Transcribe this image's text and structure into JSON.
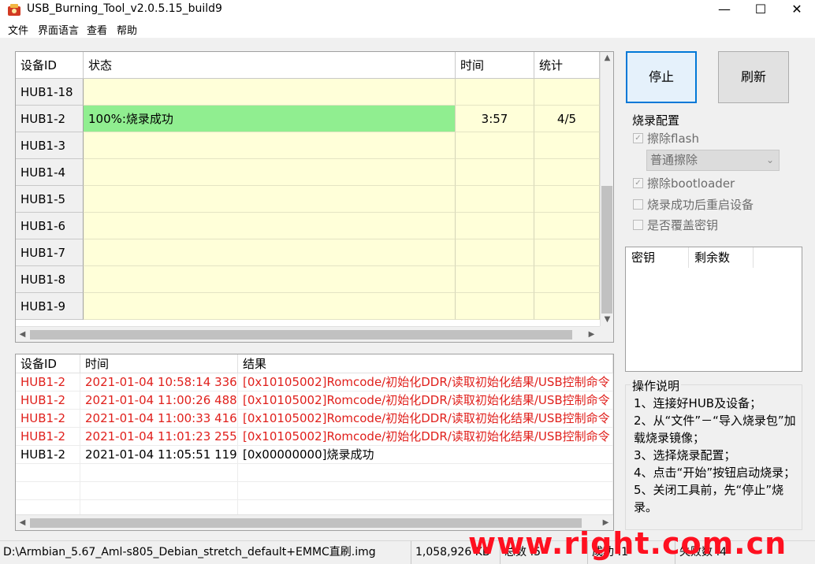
{
  "window": {
    "title": "USB_Burning_Tool_v2.0.5.15_build9",
    "minimize": "—",
    "maximize": "☐",
    "close": "✕"
  },
  "menu": [
    "文件",
    "界面语言",
    "查看",
    "帮助"
  ],
  "grid": {
    "headers": [
      "设备ID",
      "状态",
      "时间",
      "统计"
    ],
    "rows": [
      {
        "id": "HUB1-18",
        "status": "",
        "time": "",
        "stat": ""
      },
      {
        "id": "HUB1-2",
        "status": "100%:烧录成功",
        "time": "3:57",
        "stat": "4/5"
      },
      {
        "id": "HUB1-3",
        "status": "",
        "time": "",
        "stat": ""
      },
      {
        "id": "HUB1-4",
        "status": "",
        "time": "",
        "stat": ""
      },
      {
        "id": "HUB1-5",
        "status": "",
        "time": "",
        "stat": ""
      },
      {
        "id": "HUB1-6",
        "status": "",
        "time": "",
        "stat": ""
      },
      {
        "id": "HUB1-7",
        "status": "",
        "time": "",
        "stat": ""
      },
      {
        "id": "HUB1-8",
        "status": "",
        "time": "",
        "stat": ""
      },
      {
        "id": "HUB1-9",
        "status": "",
        "time": "",
        "stat": ""
      }
    ],
    "success_color": "#90ee90",
    "row_color": "#ffffd9"
  },
  "log": {
    "headers": [
      "设备ID",
      "时间",
      "结果"
    ],
    "rows": [
      {
        "id": "HUB1-2",
        "time": "2021-01-04 10:58:14 336",
        "result": "[0x10105002]Romcode/初始化DDR/读取初始化结果/USB控制命令",
        "error": true
      },
      {
        "id": "HUB1-2",
        "time": "2021-01-04 11:00:26 488",
        "result": "[0x10105002]Romcode/初始化DDR/读取初始化结果/USB控制命令",
        "error": true
      },
      {
        "id": "HUB1-2",
        "time": "2021-01-04 11:00:33 416",
        "result": "[0x10105002]Romcode/初始化DDR/读取初始化结果/USB控制命令",
        "error": true
      },
      {
        "id": "HUB1-2",
        "time": "2021-01-04 11:01:23 255",
        "result": "[0x10105002]Romcode/初始化DDR/读取初始化结果/USB控制命令",
        "error": true
      },
      {
        "id": "HUB1-2",
        "time": "2021-01-04 11:05:51 119",
        "result": "[0x00000000]烧录成功",
        "error": false
      }
    ],
    "error_color": "#e0201c"
  },
  "buttons": {
    "stop": "停止",
    "refresh": "刷新"
  },
  "config": {
    "title": "烧录配置",
    "erase_flash": {
      "label": "擦除flash",
      "checked": true
    },
    "erase_mode": "普通擦除",
    "erase_bootloader": {
      "label": "擦除bootloader",
      "checked": true
    },
    "reboot_after": {
      "label": "烧录成功后重启设备",
      "checked": false
    },
    "overwrite_key": {
      "label": "是否覆盖密钥",
      "checked": false
    }
  },
  "keys": {
    "headers": [
      "密钥",
      "剩余数"
    ]
  },
  "help": {
    "title": "操作说明",
    "text": "1、连接好HUB及设备；\n2、从“文件”－“导入烧录包”加载烧录镜像；\n3、选择烧录配置；\n4、点击“开始”按钮启动烧录；\n5、关闭工具前，先“停止”烧录。"
  },
  "statusbar": {
    "path": "D:\\Armbian_5.67_Aml-s805_Debian_stretch_default+EMMC直刷.img",
    "size": "1,058,926 KB",
    "total": "总数 :5",
    "success": "成功 :1",
    "fail": "失败数 :4"
  },
  "watermark": "www.right.com.cn"
}
